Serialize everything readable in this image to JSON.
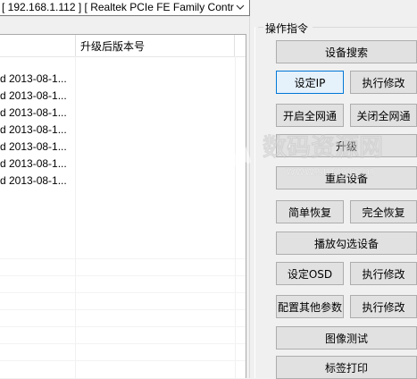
{
  "adapter_select": {
    "value": "[ 192.168.1.112 ] [ Realtek PCIe FE Family Contr"
  },
  "device_list": {
    "columns": [
      "",
      "升级后版本号"
    ],
    "rows": [
      {
        "date": "d 2013-08-1...",
        "upgraded_version": ""
      },
      {
        "date": "d 2013-08-1...",
        "upgraded_version": ""
      },
      {
        "date": "d 2013-08-1...",
        "upgraded_version": ""
      },
      {
        "date": "d 2013-08-1...",
        "upgraded_version": ""
      },
      {
        "date": "d 2013-08-1...",
        "upgraded_version": ""
      },
      {
        "date": "d 2013-08-1...",
        "upgraded_version": ""
      },
      {
        "date": "d 2013-08-1...",
        "upgraded_version": ""
      }
    ]
  },
  "commands": {
    "group_title": "操作指令",
    "device_search": "设备搜索",
    "set_ip": "设定IP",
    "execute_modify_1": "执行修改",
    "enable_all_network": "开启全网通",
    "disable_all_network": "关闭全网通",
    "upgrade": "升级",
    "reboot_device": "重启设备",
    "simple_restore": "简单恢复",
    "full_restore": "完全恢复",
    "play_checked_device": "播放勾选设备",
    "set_osd": "设定OSD",
    "execute_modify_2": "执行修改",
    "configure_other_params": "配置其他参数",
    "execute_modify_3": "执行修改",
    "image_test": "图像测试",
    "label_print": "标签打印"
  },
  "watermark": {
    "title": "数码资源网",
    "url": "www.smzy.com"
  },
  "icons": {
    "dropdown": "chevron-down-icon"
  }
}
